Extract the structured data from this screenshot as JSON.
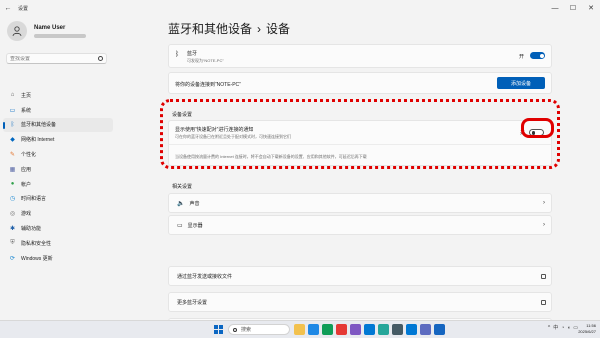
{
  "window": {
    "title": "设置",
    "back_glyph": "←",
    "min_glyph": "—",
    "max_glyph": "☐",
    "close_glyph": "✕"
  },
  "profile": {
    "name": "Name User"
  },
  "search": {
    "placeholder": "查找设置"
  },
  "nav": [
    {
      "label": "主页",
      "icon": "home-icon",
      "glyph": "⌂",
      "color": "#555555"
    },
    {
      "label": "系统",
      "icon": "system-icon",
      "glyph": "▭",
      "color": "#0067c0"
    },
    {
      "label": "蓝牙和其他设备",
      "icon": "bluetooth-devices-icon",
      "glyph": "ᛒ",
      "color": "#0067c0",
      "active": true
    },
    {
      "label": "网络和 Internet",
      "icon": "network-icon",
      "glyph": "◆",
      "color": "#0067c0"
    },
    {
      "label": "个性化",
      "icon": "personalization-icon",
      "glyph": "✎",
      "color": "#e3732b"
    },
    {
      "label": "应用",
      "icon": "apps-icon",
      "glyph": "▦",
      "color": "#5c6ba8"
    },
    {
      "label": "帐户",
      "icon": "accounts-icon",
      "glyph": "●",
      "color": "#2fa04a"
    },
    {
      "label": "时间和语言",
      "icon": "time-language-icon",
      "glyph": "◷",
      "color": "#1f8ad2"
    },
    {
      "label": "游戏",
      "icon": "gaming-icon",
      "glyph": "◎",
      "color": "#6b6b6b"
    },
    {
      "label": "辅助功能",
      "icon": "accessibility-icon",
      "glyph": "✱",
      "color": "#1f5fa8"
    },
    {
      "label": "隐私和安全性",
      "icon": "privacy-icon",
      "glyph": "⛨",
      "color": "#6b6b6b"
    },
    {
      "label": "Windows 更新",
      "icon": "windows-update-icon",
      "glyph": "⟳",
      "color": "#1f8ad2"
    }
  ],
  "header": {
    "parent": "蓝牙和其他设备",
    "separator": "›",
    "current": "设备"
  },
  "bluetooth": {
    "title": "蓝牙",
    "subtitle": "可发现为“NOTE-PC”",
    "state": "开",
    "on": true
  },
  "add_device": {
    "label": "将你的设备连接到“NOTE-PC”",
    "button": "添加设备"
  },
  "device_settings": {
    "heading": "设备设置",
    "swift_pair_title": "显示使用“快速配对”进行连接的通知",
    "swift_pair_sub": "可在你的蓝牙设备已在附近且处于配对模式时，可快速连接到它们",
    "swift_pair_state": "关",
    "swift_pair_on": false,
    "below_text": "当设备使用按流量计费的 Internet 连接时，将不会自动下载新设备的设置、应用和其他软件，可延迟后再下载"
  },
  "related": {
    "heading": "相关设置",
    "rows": [
      {
        "label": "声音",
        "icon": "sound-icon",
        "glyph": "🔈",
        "kind": "chevron"
      },
      {
        "label": "显示器",
        "icon": "display-icon",
        "glyph": "▭",
        "kind": "chevron"
      },
      {
        "label": "通过蓝牙发送或接收文件",
        "kind": "external"
      },
      {
        "label": "更多蓝牙设置",
        "kind": "external"
      },
      {
        "label": "更多设备和打印机设置",
        "kind": "external"
      }
    ]
  },
  "taskbar": {
    "search_placeholder": "搜索",
    "app_colors": [
      "#f2c14e",
      "#1e88e5",
      "#0f9d58",
      "#e53935",
      "#7e57c2",
      "#0078d4",
      "#26a69a",
      "#455a64",
      "#0078d4",
      "#5c6bc0",
      "#1565c0"
    ],
    "lang": "中",
    "time": "11:56",
    "date": "2025/6/27"
  }
}
